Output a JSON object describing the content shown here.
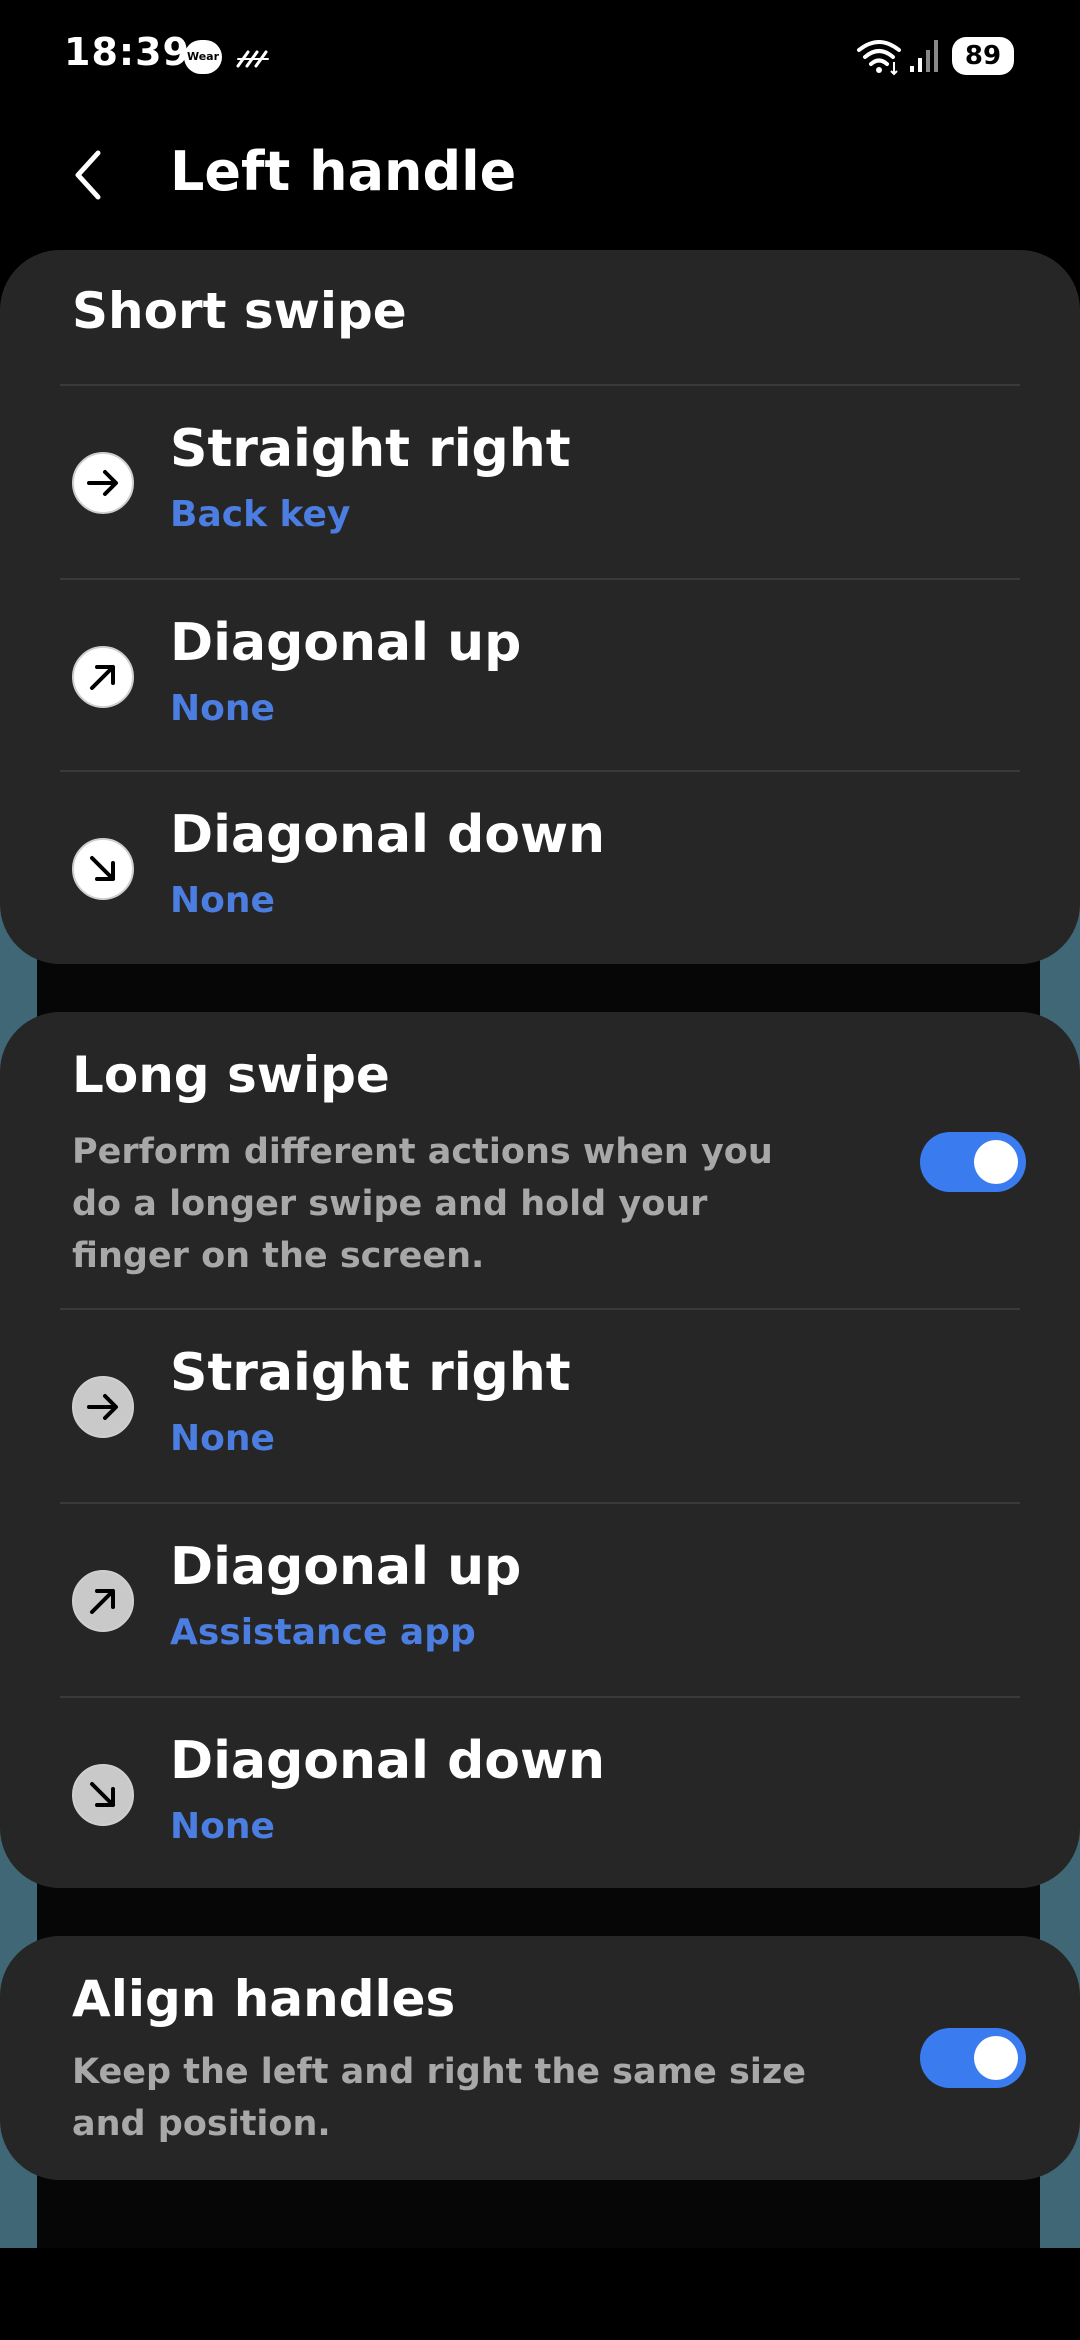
{
  "status_bar": {
    "time": "18:39",
    "wear_badge": "Wear",
    "battery": "89"
  },
  "app_bar": {
    "title": "Left handle"
  },
  "short_swipe": {
    "title": "Short swipe",
    "items": [
      {
        "label": "Straight right",
        "value": "Back key",
        "icon": "arrow-right-icon"
      },
      {
        "label": "Diagonal up",
        "value": "None",
        "icon": "arrow-up-right-icon"
      },
      {
        "label": "Diagonal down",
        "value": "None",
        "icon": "arrow-down-right-icon"
      }
    ]
  },
  "long_swipe": {
    "title": "Long swipe",
    "description": "Perform different actions when you do a longer swipe and hold your finger on the screen.",
    "enabled": true,
    "items": [
      {
        "label": "Straight right",
        "value": "None",
        "icon": "arrow-right-icon"
      },
      {
        "label": "Diagonal up",
        "value": "Assistance app",
        "icon": "arrow-up-right-icon"
      },
      {
        "label": "Diagonal down",
        "value": "None",
        "icon": "arrow-down-right-icon"
      }
    ]
  },
  "align_handles": {
    "title": "Align handles",
    "description": "Keep the left and right the same size and position.",
    "enabled": true
  },
  "colors": {
    "accent": "#3b7bf0",
    "value_text": "#4b7ee0",
    "card": "#262626",
    "handle_overlay": "#3f6775"
  }
}
